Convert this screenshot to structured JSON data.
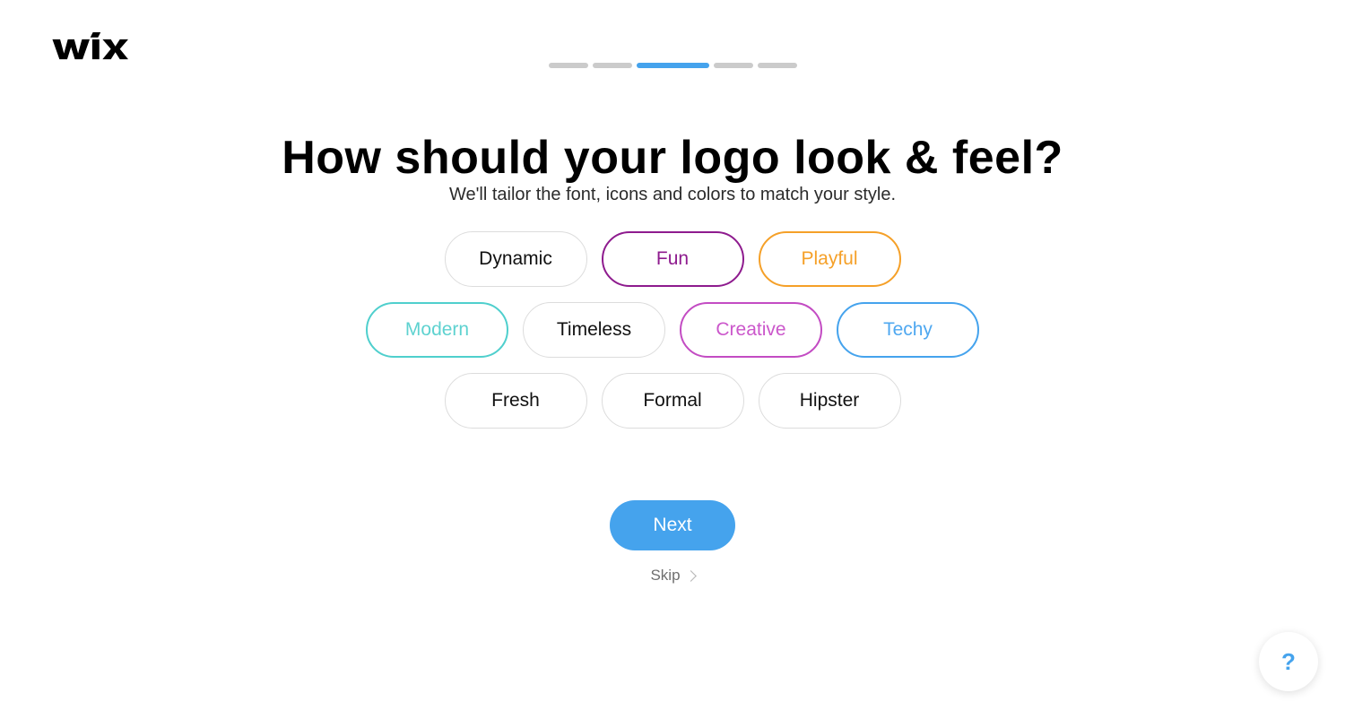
{
  "brand": {
    "logo_text": "WiX"
  },
  "progress": {
    "steps": [
      {
        "state": "inactive"
      },
      {
        "state": "inactive"
      },
      {
        "state": "active"
      },
      {
        "state": "inactive"
      },
      {
        "state": "inactive"
      }
    ],
    "active_color": "#45a3ed",
    "inactive_color": "#cbcbcb",
    "current_step": 3,
    "total_steps": 5
  },
  "header": {
    "title": "How should your logo look & feel?",
    "subtitle": "We'll tailor the font, icons and colors to match your style."
  },
  "options": {
    "rows": [
      [
        {
          "label": "Dynamic",
          "selected": false,
          "color": "#111111",
          "border": "#dcdcdc"
        },
        {
          "label": "Fun",
          "selected": true,
          "color": "#8e1b8e",
          "border": "#8e1b8e"
        },
        {
          "label": "Playful",
          "selected": true,
          "color": "#f5a028",
          "border": "#f5a028"
        }
      ],
      [
        {
          "label": "Modern",
          "selected": true,
          "color": "#5ed2d0",
          "border": "#4fcfcd"
        },
        {
          "label": "Timeless",
          "selected": false,
          "color": "#111111",
          "border": "#dcdcdc"
        },
        {
          "label": "Creative",
          "selected": true,
          "color": "#cb57cb",
          "border": "#c34cc3"
        },
        {
          "label": "Techy",
          "selected": true,
          "color": "#4fa8f0",
          "border": "#45a3ed"
        }
      ],
      [
        {
          "label": "Fresh",
          "selected": false,
          "color": "#111111",
          "border": "#dcdcdc"
        },
        {
          "label": "Formal",
          "selected": false,
          "color": "#111111",
          "border": "#dcdcdc"
        },
        {
          "label": "Hipster",
          "selected": false,
          "color": "#111111",
          "border": "#dcdcdc"
        }
      ]
    ]
  },
  "actions": {
    "next_label": "Next",
    "next_color": "#45a3ed",
    "skip_label": "Skip",
    "skip_icon": "chevron-right-icon"
  },
  "help": {
    "icon": "question-mark-icon",
    "glyph": "?",
    "color": "#45a3ed"
  }
}
